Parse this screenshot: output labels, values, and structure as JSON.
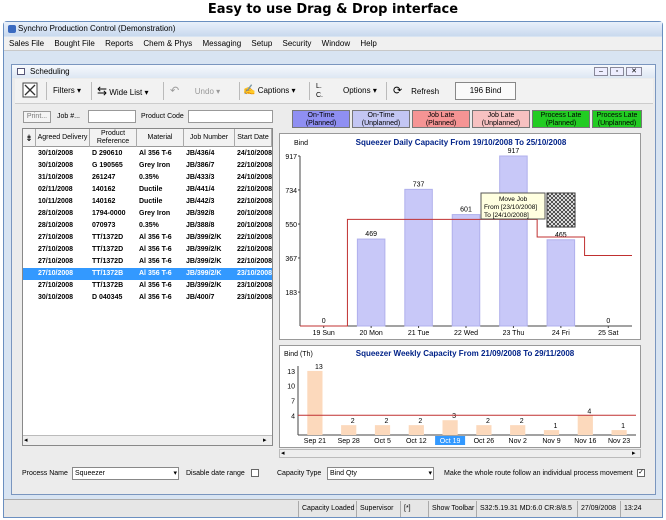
{
  "caption": "Easy to use Drag & Drop interface",
  "app_title": "Synchro Production Control (Demonstration)",
  "menu": [
    "Sales File",
    "Bought File",
    "Reports",
    "Chem & Phys",
    "Messaging",
    "Setup",
    "Security",
    "Window",
    "Help"
  ],
  "child_title": "Scheduling",
  "toolbar": {
    "filters": "Filters",
    "wide_list": "Wide List",
    "undo": "Undo",
    "captions": "Captions",
    "options": "Options",
    "refresh": "Refresh",
    "bind_count": "196 Bind",
    "opt_l": "L.",
    "opt_c": "C."
  },
  "filter": {
    "print": "Print...",
    "job_label": "Job #...",
    "job_value": "",
    "product_label": "Product Code",
    "product_value": ""
  },
  "legend": [
    {
      "l1": "On-Time",
      "l2": "(Planned)",
      "color": "#8f8ff2"
    },
    {
      "l1": "On-Time",
      "l2": "(Unplanned)",
      "color": "#c3c6f3"
    },
    {
      "l1": "Job Late",
      "l2": "(Planned)",
      "color": "#f59494"
    },
    {
      "l1": "Job Late",
      "l2": "(Unplanned)",
      "color": "#f7c1c1"
    },
    {
      "l1": "Process Late",
      "l2": "(Planned)",
      "color": "#22cc22"
    },
    {
      "l1": "Process Late",
      "l2": "(Unplanned)",
      "color": "#22cc22"
    }
  ],
  "grid": {
    "columns": [
      "Agreed Delivery",
      "Product Reference",
      "Material",
      "Job Number",
      "Start Date"
    ],
    "rows": [
      [
        "30/10/2008",
        "D 290610",
        "Al 356 T-6",
        "JB/436/4",
        "24/10/2008"
      ],
      [
        "30/10/2008",
        "G 190565",
        "Grey Iron",
        "JB/386/7",
        "22/10/2008"
      ],
      [
        "31/10/2008",
        "261247",
        "0.35%",
        "JB/433/3",
        "24/10/2008"
      ],
      [
        "02/11/2008",
        "140162",
        "Ductile",
        "JB/441/4",
        "22/10/2008"
      ],
      [
        "10/11/2008",
        "140162",
        "Ductile",
        "JB/442/3",
        "22/10/2008"
      ],
      [
        "28/10/2008",
        "1794-0000",
        "Grey Iron",
        "JB/392/8",
        "20/10/2008"
      ],
      [
        "28/10/2008",
        "070973",
        "0.35%",
        "JB/388/8",
        "20/10/2008"
      ],
      [
        "27/10/2008",
        "TT/1372D",
        "Al 356 T-6",
        "JB/399/2/K",
        "22/10/2008"
      ],
      [
        "27/10/2008",
        "TT/1372D",
        "Al 356 T-6",
        "JB/399/2/K",
        "22/10/2008"
      ],
      [
        "27/10/2008",
        "TT/1372D",
        "Al 356 T-6",
        "JB/399/2/K",
        "22/10/2008"
      ],
      [
        "27/10/2008",
        "TT/1372B",
        "Al 356 T-6",
        "JB/399/2/K",
        "23/10/2008"
      ],
      [
        "27/10/2008",
        "TT/1372B",
        "Al 356 T-6",
        "JB/399/2/K",
        "23/10/2008"
      ],
      [
        "30/10/2008",
        "D 040345",
        "Al 356 T-6",
        "JB/400/7",
        "23/10/2008"
      ]
    ],
    "selected_row": 10
  },
  "chart_data": [
    {
      "type": "bar",
      "title": "Squeezer Daily Capacity From 19/10/2008 To 25/10/2008",
      "ylabel": "Bind",
      "categories": [
        "19 Sun",
        "20 Mon",
        "21 Tue",
        "22 Wed",
        "23 Thu",
        "24 Fri",
        "25 Sat"
      ],
      "values": [
        0,
        469,
        737,
        601,
        917,
        465,
        0
      ],
      "yticks": [
        183,
        367,
        550,
        734,
        917
      ],
      "ylim": [
        0,
        917
      ],
      "capacity_line": [
        0,
        575,
        575,
        575,
        575,
        480,
        380
      ],
      "tooltip": {
        "line1": "Move Job",
        "line2": "From [23/10/2008]",
        "line3": "To    [24/10/2008]"
      }
    },
    {
      "type": "bar",
      "title": "Squeezer Weekly Capacity From 21/09/2008 To 29/11/2008",
      "ylabel": "Bind (Th)",
      "categories": [
        "Sep 21",
        "Sep 28",
        "Oct 5",
        "Oct 12",
        "Oct 19",
        "Oct 26",
        "Nov 2",
        "Nov 9",
        "Nov 16",
        "Nov 23"
      ],
      "values": [
        13,
        2,
        2,
        2,
        3,
        2,
        2,
        1,
        4,
        1
      ],
      "yticks": [
        4,
        7,
        10,
        13
      ],
      "ylim": [
        0,
        14
      ],
      "capacity_line": [
        4,
        4,
        4,
        4,
        4,
        4,
        4,
        4,
        4,
        4
      ],
      "selected_category": "Oct 19"
    }
  ],
  "bottom": {
    "process_label": "Process Name",
    "process_value": "Squeezer",
    "disable_label": "Disable date range",
    "captype_label": "Capacity Type",
    "captype_value": "Bind Qty",
    "route_label": "Make the whole route follow an individual process movement"
  },
  "status": [
    "Capacity Loaded",
    "Supervisor",
    "[*]",
    "Show Toolbar",
    "S32:5.19.31 MD:6.0 CR:8/8.5",
    "27/09/2008",
    "13:24"
  ]
}
